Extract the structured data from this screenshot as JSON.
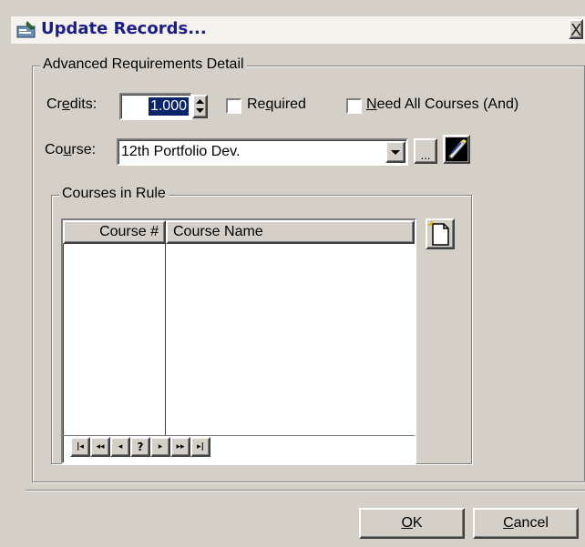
{
  "window": {
    "title": "Update Records...",
    "close_glyph": "X"
  },
  "group_main": {
    "legend": "Advanced Requirements Detail"
  },
  "credits": {
    "label_pre": "Cr",
    "label_u": "e",
    "label_post": "dits:",
    "value": "1.000",
    "required_pre": "Re",
    "required_u": "q",
    "required_post": "uired",
    "need_all_u": "N",
    "need_all_post": "eed All Courses (And)"
  },
  "course": {
    "label_pre": "Co",
    "label_u": "u",
    "label_post": "rse:",
    "selected": "12th Portfolio Dev.",
    "browse_label": "..."
  },
  "group_rule": {
    "legend": "Courses in Rule"
  },
  "grid": {
    "columns": [
      "Course #",
      "Course Name"
    ],
    "nav_buttons": [
      "|◂",
      "◂◂",
      "◂",
      "?",
      "▸",
      "▸▸",
      "▸|"
    ]
  },
  "buttons": {
    "ok_u": "O",
    "ok_post": "K",
    "cancel_u": "C",
    "cancel_post": "ancel"
  },
  "icons": {
    "title": "form-icon",
    "edit": "pencil-icon",
    "new": "new-document-icon",
    "dropdown": "dropdown-arrow-icon",
    "spinner": "spinner-arrows-icon"
  }
}
